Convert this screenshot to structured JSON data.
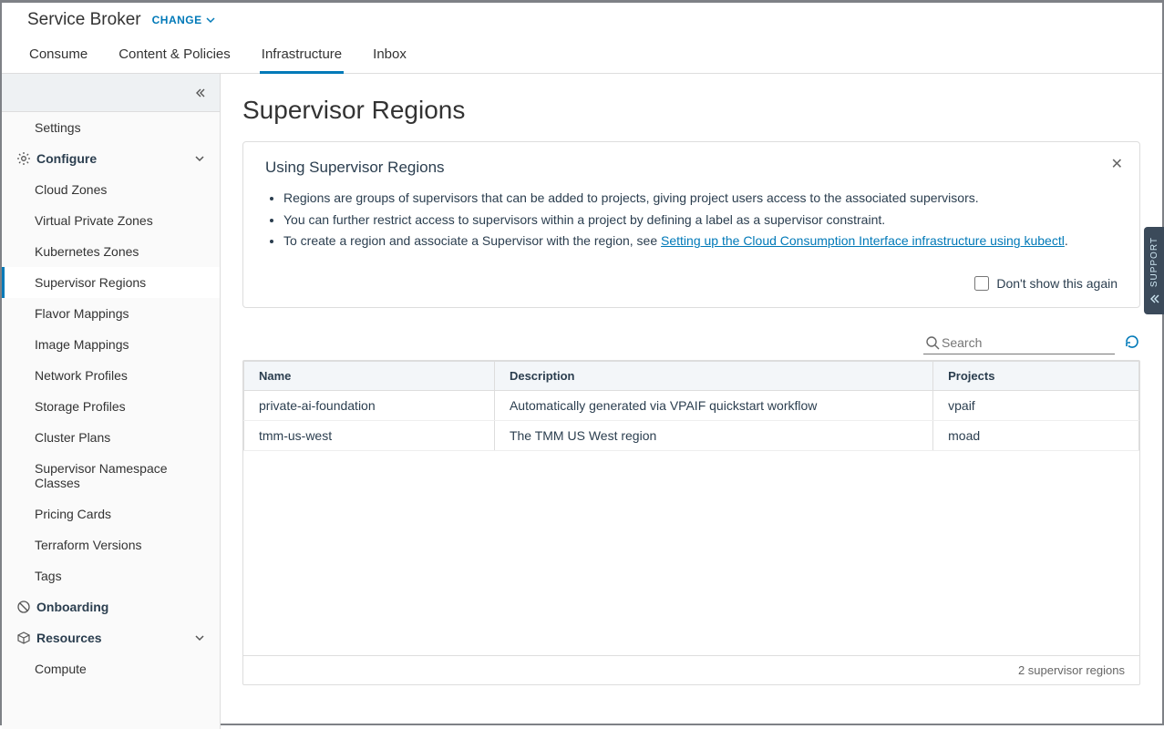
{
  "header": {
    "app_title": "Service Broker",
    "change_label": "CHANGE"
  },
  "tabs": [
    {
      "id": "consume",
      "label": "Consume"
    },
    {
      "id": "content",
      "label": "Content & Policies"
    },
    {
      "id": "infra",
      "label": "Infrastructure",
      "active": true
    },
    {
      "id": "inbox",
      "label": "Inbox"
    }
  ],
  "sidebar": {
    "settings": "Settings",
    "configure": "Configure",
    "onboarding": "Onboarding",
    "resources": "Resources",
    "configure_items": [
      "Cloud Zones",
      "Virtual Private Zones",
      "Kubernetes Zones",
      "Supervisor Regions",
      "Flavor Mappings",
      "Image Mappings",
      "Network Profiles",
      "Storage Profiles",
      "Cluster Plans",
      "Supervisor Namespace Classes",
      "Pricing Cards",
      "Terraform Versions",
      "Tags"
    ],
    "resources_items": [
      "Compute"
    ]
  },
  "page": {
    "title": "Supervisor Regions",
    "info_title": "Using Supervisor Regions",
    "bullets": [
      "Regions are groups of supervisors that can be added to projects, giving project users access to the associated supervisors.",
      "You can further restrict access to supervisors within a project by defining a label as a supervisor constraint."
    ],
    "bullet3_prefix": "To create a region and associate a Supervisor with the region, see ",
    "bullet3_link": "Setting up the Cloud Consumption Interface infrastructure using kubectl",
    "bullet3_suffix": ".",
    "dont_show": "Don't show this again",
    "search_placeholder": "Search",
    "columns": {
      "name": "Name",
      "description": "Description",
      "projects": "Projects"
    },
    "rows": [
      {
        "name": "private-ai-foundation",
        "description": "Automatically generated via VPAIF quickstart workflow",
        "projects": "vpaif"
      },
      {
        "name": "tmm-us-west",
        "description": "The TMM US West region",
        "projects": "moad"
      }
    ],
    "footer": "2 supervisor regions"
  },
  "support_label": "SUPPORT"
}
